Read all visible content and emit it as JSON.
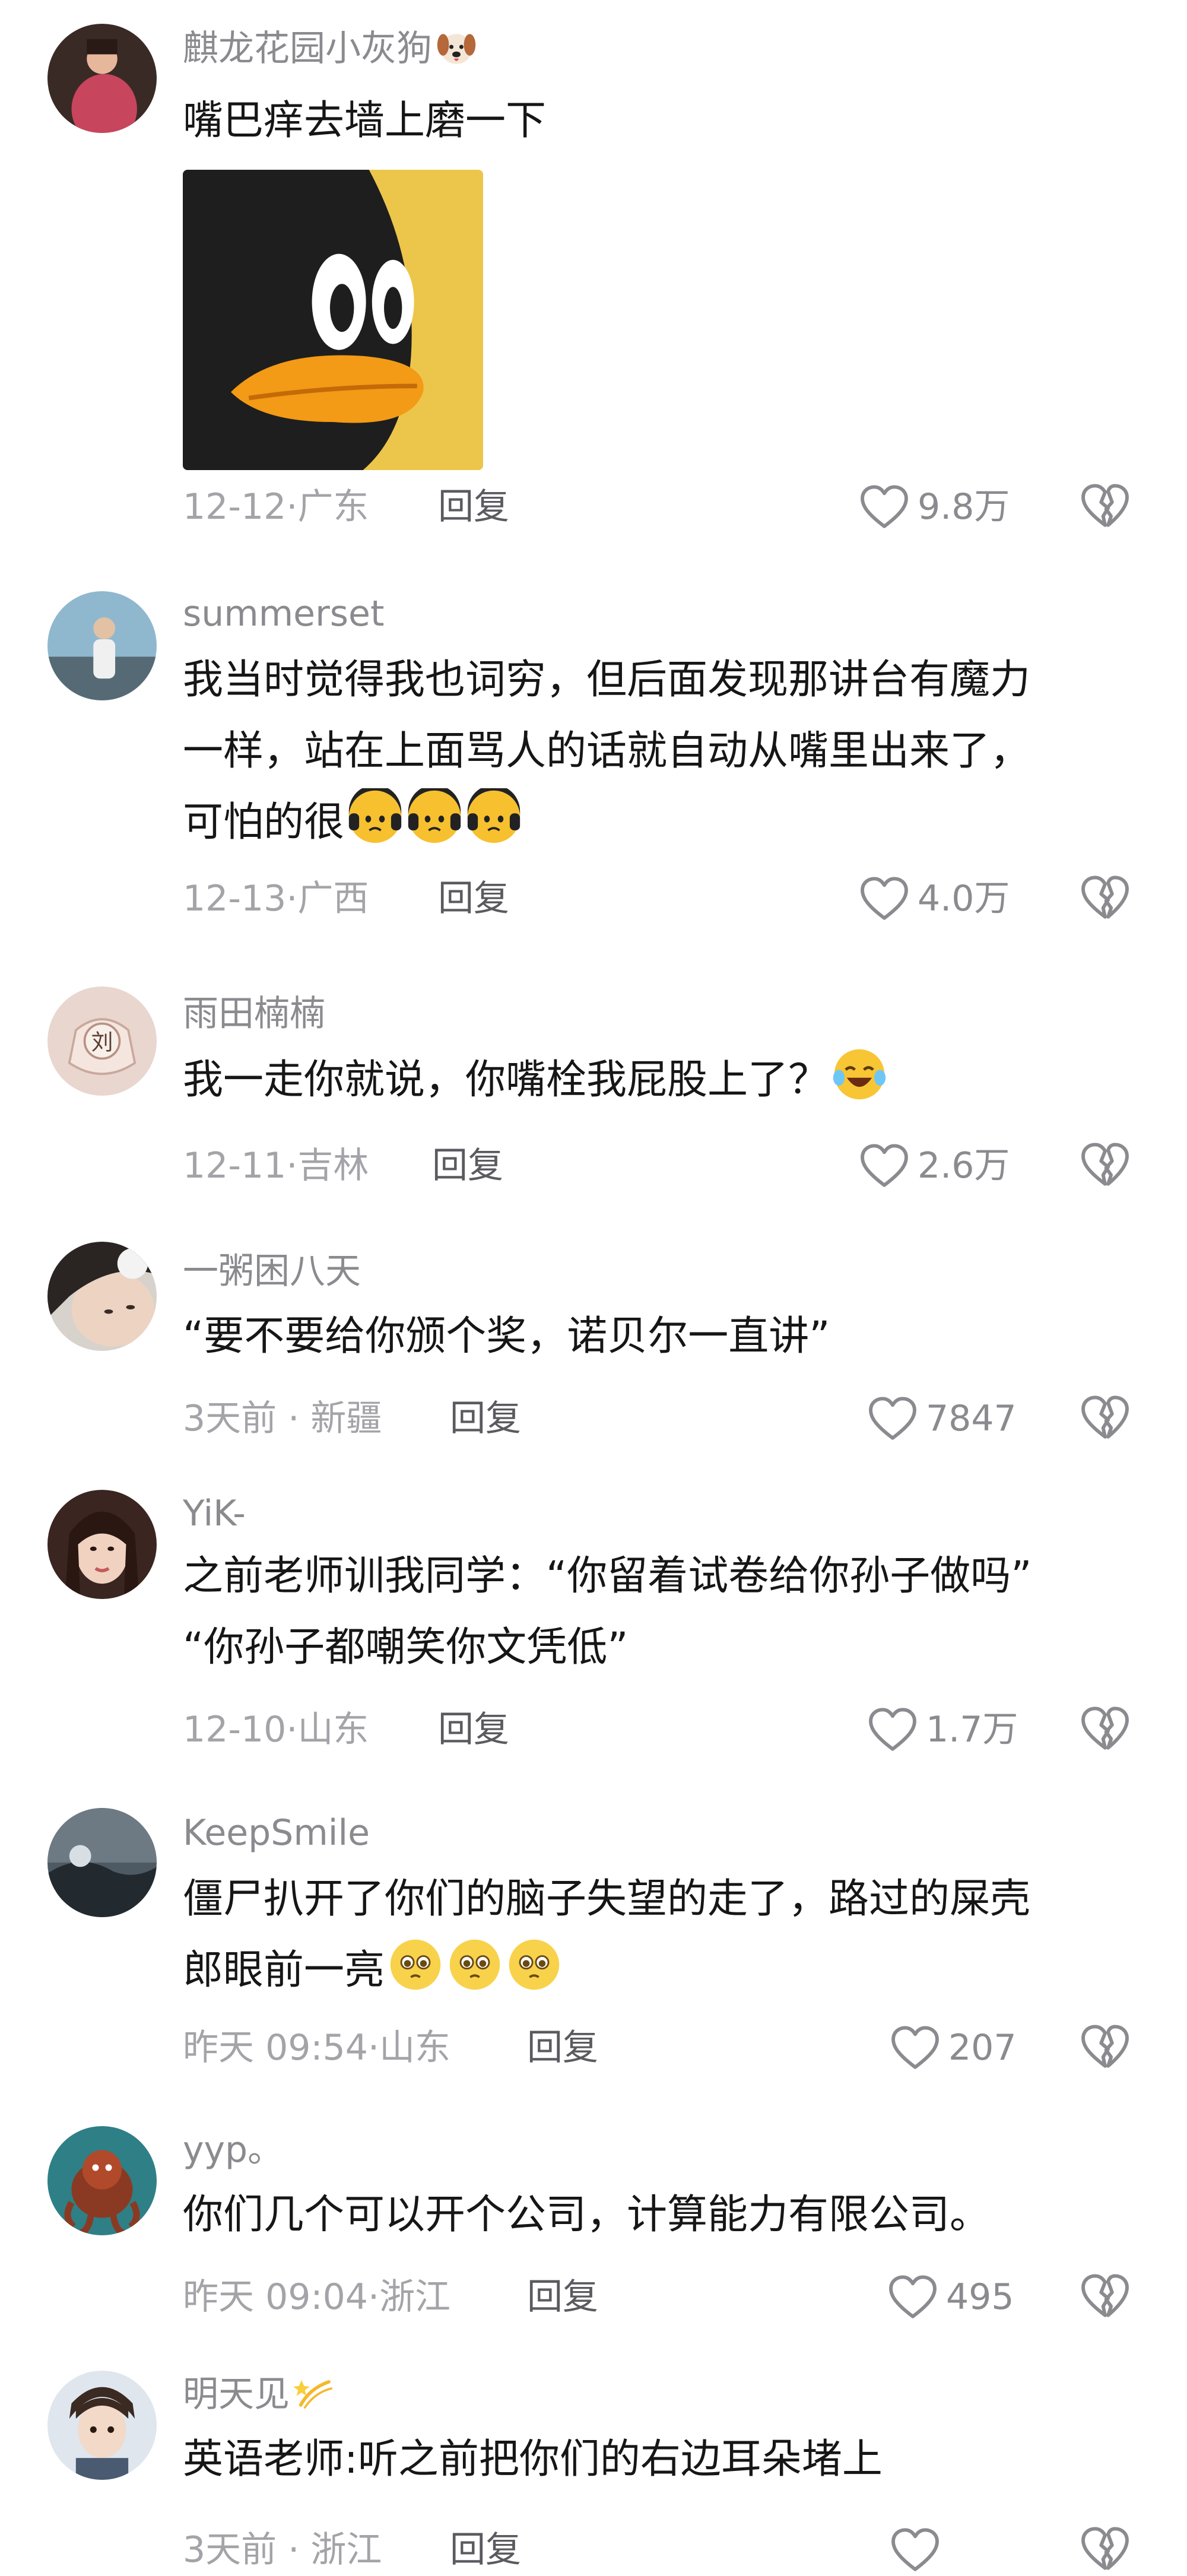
{
  "comments": [
    {
      "username": "麒龙花园小灰狗",
      "username_emoji": "dog-face-emoji",
      "lines": [
        "嘴巴痒去墙上磨一下"
      ],
      "sticker": "penguin-sticker",
      "date": "12-12",
      "location": "广东",
      "reply_label": "回复",
      "likes": "9.8万"
    },
    {
      "username": "summerset",
      "lines": [
        "我当时觉得我也词穷，但后面发现那讲台有魔力",
        "一样，站在上面骂人的话就自动从嘴里出来了，",
        "可怕的很"
      ],
      "inline_emoji": "sweating-face-emoji",
      "inline_emoji_count": 3,
      "date": "12-13",
      "location": "广西",
      "reply_label": "回复",
      "likes": "4.0万"
    },
    {
      "username": "雨田楠楠",
      "avatar_text": "刘",
      "lines": [
        "我一走你就说，你嘴栓我屁股上了？"
      ],
      "inline_emoji": "crying-laughing-emoji",
      "inline_emoji_count": 1,
      "date": "12-11",
      "location": "吉林",
      "reply_label": "回复",
      "likes": "2.6万"
    },
    {
      "username": "一粥困八天",
      "lines": [
        "“要不要给你颁个奖，诺贝尔一直讲”"
      ],
      "date": "3天前",
      "location": "新疆",
      "reply_label": "回复",
      "likes": "7847"
    },
    {
      "username": "YiK-",
      "lines": [
        "之前老师训我同学：“你留着试卷给你孙子做吗”",
        "“你孙子都嘲笑你文凭低”"
      ],
      "date": "12-10",
      "location": "山东",
      "reply_label": "回复",
      "likes": "1.7万"
    },
    {
      "username": "KeepSmile",
      "lines": [
        "僵尸扒开了你们的脑子失望的走了，路过的屎壳",
        "郎眼前一亮"
      ],
      "inline_emoji": "pleading-face-emoji",
      "inline_emoji_count": 3,
      "date": "昨天 09:54",
      "location": "山东",
      "reply_label": "回复",
      "likes": "207"
    },
    {
      "username": "yyp。",
      "lines": [
        "你们几个可以开个公司，计算能力有限公司。"
      ],
      "date": "昨天 09:04",
      "location": "浙江",
      "reply_label": "回复",
      "likes": "495"
    },
    {
      "username": "明天见",
      "username_emoji": "dizzy-emoji",
      "lines": [
        "英语老师:听之前把你们的右边耳朵堵上"
      ],
      "date": "3天前",
      "location": "浙江",
      "reply_label": "回复",
      "likes": ""
    }
  ],
  "colors": {
    "username": "#8a8a8f",
    "text": "#161616",
    "meta": "#a3a3a8",
    "reply": "#5a5a60",
    "icon": "#8a8a8f"
  }
}
